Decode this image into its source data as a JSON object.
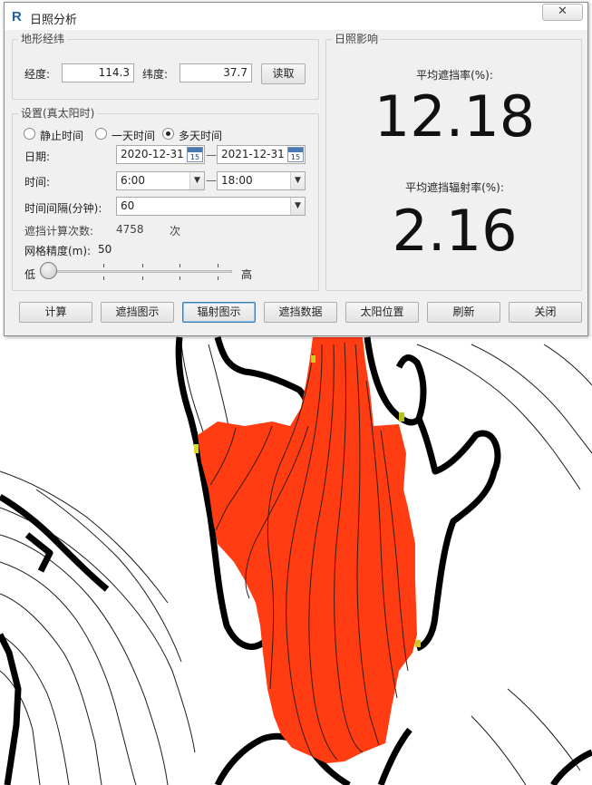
{
  "window": {
    "title": "日照分析",
    "app_icon_letter": "R",
    "close_symbol": "✕"
  },
  "terrain": {
    "group_title": "地形经纬",
    "longitude_label": "经度:",
    "longitude_value": "114.3",
    "latitude_label": "纬度:",
    "latitude_value": "37.7",
    "read_button": "读取"
  },
  "settings": {
    "group_title": "设置(真太阳时)",
    "modes": [
      {
        "label": "静止时间",
        "checked": false
      },
      {
        "label": "一天时间",
        "checked": false
      },
      {
        "label": "多天时间",
        "checked": true
      }
    ],
    "date_label": "日期:",
    "date_start": "2020-12-31",
    "date_end": "2021-12-31",
    "cal_icon_text": "15",
    "range_dash": "—",
    "time_label": "时间:",
    "time_start": "6:00",
    "time_end": "18:00",
    "interval_label": "时间间隔(分钟):",
    "interval_value": "60",
    "count_label": "遮挡计算次数:",
    "count_value": "4758",
    "count_unit": "次",
    "grid_label": "网格精度(m):",
    "grid_value": "50",
    "slider_low": "低",
    "slider_high": "高",
    "slider_level": 0.0
  },
  "result": {
    "group_title": "日照影响",
    "avg_block_label": "平均遮挡率(%):",
    "avg_block_value": "12.18",
    "avg_radiation_label": "平均遮挡辐射率(%):",
    "avg_radiation_value": "2.16"
  },
  "buttons": {
    "calculate": "计算",
    "shading_map": "遮挡图示",
    "radiation_map": "辐射图示",
    "shading_data": "遮挡数据",
    "sun_position": "太阳位置",
    "refresh": "刷新",
    "close": "关闭"
  },
  "colors": {
    "shading_area": "#ff3c12",
    "contour_line": "#1a1a1a",
    "accent_blue": "#3c7fb1"
  }
}
